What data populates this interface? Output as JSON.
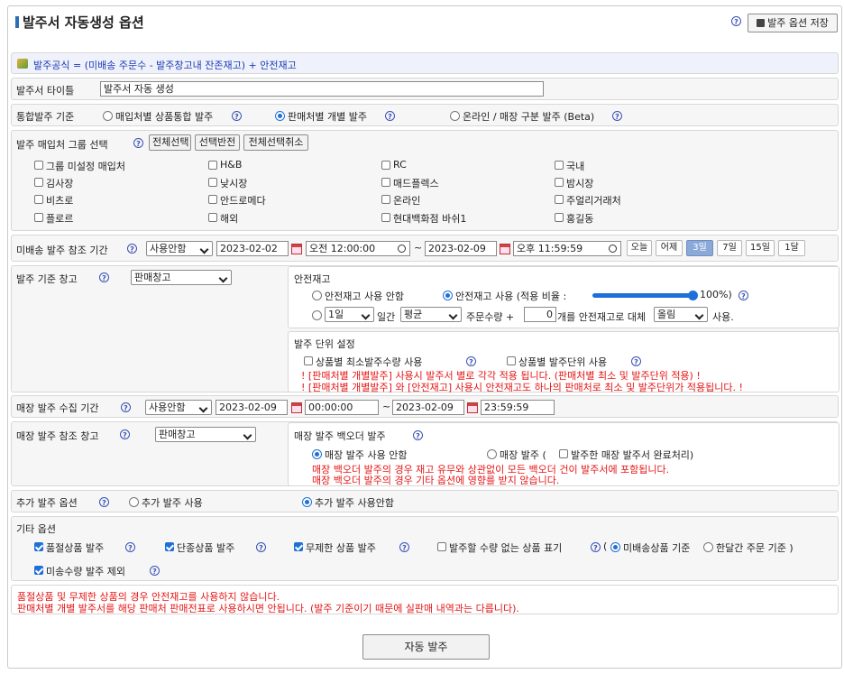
{
  "header": {
    "title": "발주서 자동생성 옵션",
    "save_label": "발주 옵션 저장"
  },
  "formula": {
    "text": "발주공식 = (미배송 주문수 - 발주창고내 잔존재고) + 안전재고"
  },
  "po_title": {
    "label": "발주서 타이틀",
    "value": "발주서 자동 생성"
  },
  "integration": {
    "label": "통합발주 기준",
    "options": [
      "매입처별 상품통합 발주",
      "판매처별 개별 발주",
      "온라인 / 매장 구분 발주 (Beta)"
    ]
  },
  "groups": {
    "label": "발주 매입처 그룹 선택",
    "buttons": [
      "전체선택",
      "선택반전",
      "전체선택취소"
    ],
    "items": [
      "그룹 미설정 매입처",
      "H&B",
      "RC",
      "국내",
      "김사장",
      "낮시장",
      "매드플렉스",
      "밤시장",
      "비츠로",
      "안드로메다",
      "온라인",
      "주얼리거래처",
      "플로르",
      "해외",
      "현대백화점 바쉬1",
      "홍길동"
    ]
  },
  "period": {
    "label": "미배송 발주 참조 기간",
    "mode": "사용안함",
    "start_date": "2023-02-02",
    "start_time": "오전 12:00:00",
    "tilde": "~",
    "end_date": "2023-02-09",
    "end_time": "오후 11:59:59",
    "presets": [
      "오늘",
      "어제",
      "3일",
      "7일",
      "15일",
      "1달"
    ]
  },
  "warehouse": {
    "label": "발주 기준 창고",
    "value": "판매창고"
  },
  "safety": {
    "title": "안전재고",
    "opt_none": "안전재고 사용 안함",
    "opt_use": "안전재고 사용 (적용 비율 :",
    "ratio": "100%)",
    "ratio_value": 100,
    "period_value": "1일",
    "between": "일간",
    "avg": "평균",
    "order_qty": "주문수량 +",
    "qty": "0",
    "replace": "개를 안전재고로 대체",
    "round": "올림",
    "use": "사용."
  },
  "unit": {
    "title": "발주 단위 설정",
    "min_qty": "상품별 최소발주수량 사용",
    "unit_use": "상품별 발주단위 사용",
    "note1": "! [판매처별 개별발주] 사용시 발주서 별로 각각 적용 됩니다. (판매처별 최소 및 발주단위 적용) !",
    "note2": "! [판매처별 개별발주] 와 [안전재고] 사용시 안전재고도 하나의 판매처로 최소 및 발주단위가 적용됩니다. !"
  },
  "store_period": {
    "label": "매장 발주 수집 기간",
    "mode": "사용안함",
    "start_date": "2023-02-09",
    "start_time": "00:00:00",
    "tilde": "~",
    "end_date": "2023-02-09",
    "end_time": "23:59:59"
  },
  "store_warehouse": {
    "label": "매장 발주 참조 창고",
    "value": "판매창고"
  },
  "backorder": {
    "title": "매장 발주 백오더 발주",
    "opt_none": "매장 발주 사용 안함",
    "opt_use": "매장 발주 (",
    "complete": "발주한 매장 발주서 완료처리)",
    "note1": "매장 백오더 발주의 경우 재고 유무와 상관없이 모든 백오더 건이 발주서에 포함됩니다.",
    "note2": "매장 백오더 발주의 경우 기타 옵션에 영향를 받지 않습니다."
  },
  "extra": {
    "label": "추가 발주 옵션",
    "opt_use": "추가 발주 사용",
    "opt_none": "추가 발주 사용안함"
  },
  "etc": {
    "title": "기타 옵션",
    "soldout": "품절상품 발주",
    "discontinued": "단종상품 발주",
    "unlimited": "무제한 상품 발주",
    "no_qty": "발주할 수량 없는 상품 표기",
    "paren_open": "(",
    "undelivered": "미배송상품 기준",
    "monthly": "한달간 주문 기준 )",
    "exclude": "미송수량 발주 제외"
  },
  "warning": {
    "line1": "품절상품 및 무제한 상품의 경우 안전재고를 사용하지 않습니다.",
    "line2": "판매처별 개별 발주서를 해당 판매처 판매전표로 사용하시면 안됩니다. (발주 기준이기 때문에 실판매 내역과는 다릅니다)."
  },
  "action": {
    "label": "자동 발주"
  },
  "colors": {
    "accent": "#1f6fd8",
    "warning": "#e51616",
    "formula": "#1a3bb5"
  },
  "icons": {
    "help": "?",
    "save": "floppy-icon",
    "calendar": "calendar-icon",
    "clock": "clock-icon"
  }
}
